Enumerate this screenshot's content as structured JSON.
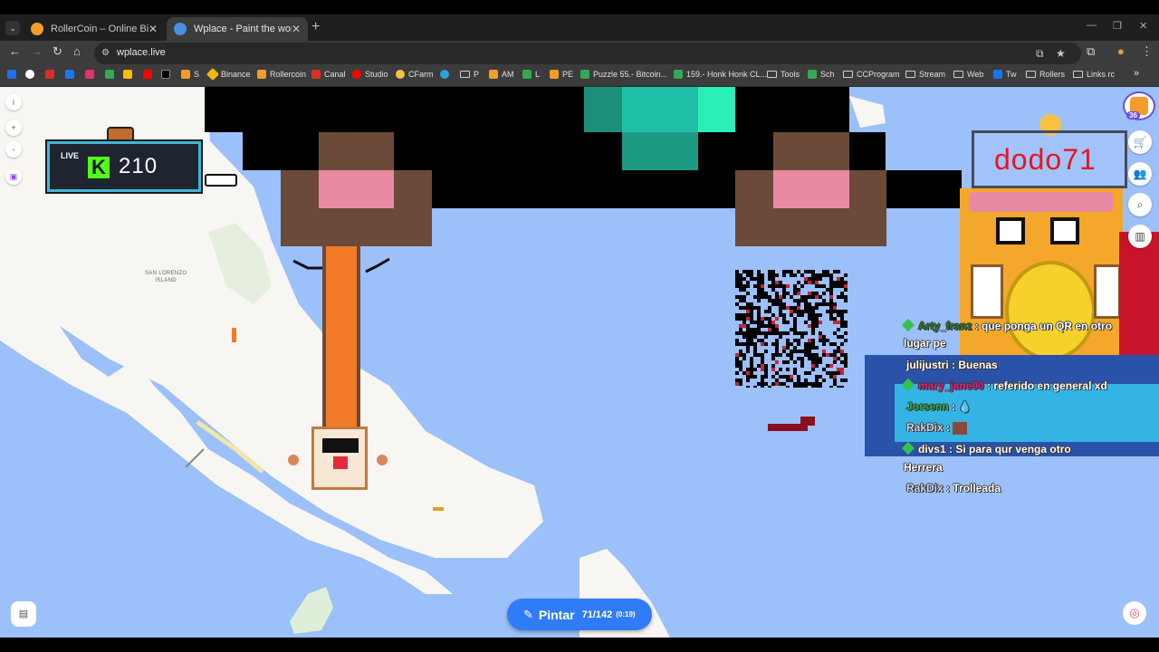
{
  "browser": {
    "tabs": [
      {
        "title": "RollerCoin – Online Bitcoin Mi",
        "active": false
      },
      {
        "title": "Wplace - Paint the world",
        "active": true
      }
    ],
    "url": "wplace.live",
    "bookmarks": [
      "S",
      "Binance",
      "Rollercoin",
      "Canal",
      "Studio",
      "CFarm",
      "P",
      "AM",
      "L",
      "PE",
      "Puzzle 55.- Bitcoin...",
      "159.- Honk Honk CL...",
      "Tools",
      "Sch",
      "CCProgram",
      "Stream",
      "Web",
      "Tw",
      "Rollers",
      "Links rc"
    ],
    "more_bookmarks": "»"
  },
  "map": {
    "label_line1": "SAN LORENZO",
    "label_line2": "ISLAND",
    "controls": {
      "info": "i",
      "zoom_in": "+",
      "zoom_out": "-"
    }
  },
  "live_badge": {
    "label": "LIVE",
    "count": "210",
    "icon": "kick-icon",
    "accent": "#53fc18"
  },
  "user": {
    "level": "36"
  },
  "paint_button": {
    "label": "Pintar",
    "count": "71/142",
    "timer": "(0:19)",
    "color": "#2f7cf6"
  },
  "overlay": {
    "username": "dodo71",
    "name_color": "#e8141f"
  },
  "chat": [
    {
      "user": "Arty_franz",
      "sep": " : ",
      "text": "que ponga un QR en otro",
      "cont": "lugar pe",
      "user_color": "#2e7d32",
      "badge": true
    },
    {
      "user": "julijustri",
      "sep": " : ",
      "text": "Buenas",
      "user_color": "#ffffff",
      "badge": false
    },
    {
      "user": "mary_jane00",
      "sep": " : ",
      "text": "referido en general xd",
      "user_color": "#e0208a",
      "badge": true
    },
    {
      "user": "Jorsenn",
      "sep": " : ",
      "text": "",
      "user_color": "#2bb24c",
      "badge": false
    },
    {
      "user": "RakDix",
      "sep": " : ",
      "text": "",
      "user_color": "#c9d4ef",
      "badge": false
    },
    {
      "user": "divs1",
      "sep": " : ",
      "text": "Si para qur venga otro",
      "cont": "Herrera",
      "user_color": "#ffffff",
      "badge": true
    },
    {
      "user": "RakDix",
      "sep": " : ",
      "text": "Trolleada",
      "user_color": "#c9d4ef",
      "badge": false
    }
  ]
}
